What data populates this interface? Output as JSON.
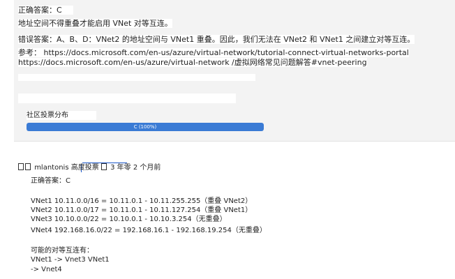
{
  "answer": {
    "correct_answer": "正确答案：C",
    "explanation": "地址空间不得重叠才能启用 VNet 对等互连。",
    "wrong_answer": "错误答案：A、B、D：VNet2 的地址空间与 VNet1 重叠。因此，我们无法在 VNet2 和 VNet1 之间建立对等互连。",
    "reference_line1": "参考： https://docs.microsoft.com/en-us/azure/virtual-network/tutorial-connect-virtual-networks-portal",
    "reference_line2": "https://docs.microsoft.com/en-us/azure/virtual-network /虚拟网络常见问题解答#vnet-peering"
  },
  "votes": {
    "label": "社区投票分布",
    "bar_text": "C (100%)",
    "fill_percent": 100,
    "bar_color": "#3a7bd5"
  },
  "comment": {
    "username": "mlantonis",
    "badge": "高度投票",
    "time": "3 年零 2 个月前",
    "correct_answer": "正确答案：C",
    "lines": [
      "VNet1 10.11.0.0/16 = 10.11.0.1 - 10.11.255.255（重叠 VNet2）",
      "VNet2 10.11.0.0/17 = 10.11.0.1 - 10.11.127.254（重叠 VNet1）",
      "VNet3 10.10.0.0/22 = 10.10.0.1 - 10.10.3.254（无重叠）",
      "VNet4 192.168.16.0/22 = 192.168.16.1 - 192.168.19.254（无重叠）"
    ],
    "possible_title": "可能的对等互连有：",
    "possible_lines": [
      "VNet1 -> Vnet3 VNet1",
      "-> Vnet4"
    ]
  }
}
